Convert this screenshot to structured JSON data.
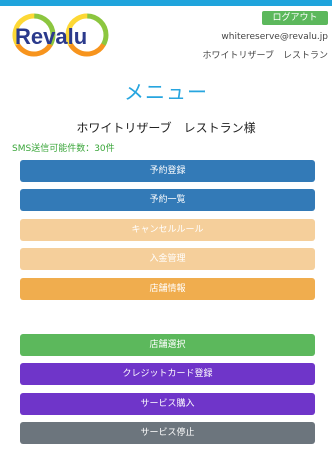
{
  "header": {
    "logo_text": "Revalu",
    "logout_label": "ログアウト",
    "user_email": "whitereserve@revalu.jp",
    "restaurant_name": "ホワイトリザーブ　レストラン"
  },
  "main": {
    "title": "メニュー",
    "restaurant_greeting": "ホワイトリザーブ　レストラン様",
    "sms_count_text": "SMS送信可能件数：30件"
  },
  "menu": {
    "items": [
      {
        "label": "予約登録",
        "color": "#337ab7"
      },
      {
        "label": "予約一覧",
        "color": "#337ab7"
      },
      {
        "label": "キャンセルルール",
        "color": "#f5cf9b"
      },
      {
        "label": "入金管理",
        "color": "#f5cf9b"
      },
      {
        "label": "店舗情報",
        "color": "#f0ad4e"
      },
      {
        "label": "店舗選択",
        "color": "#5cb85c"
      },
      {
        "label": "クレジットカード登録",
        "color": "#6f35c9"
      },
      {
        "label": "サービス購入",
        "color": "#6f35c9"
      },
      {
        "label": "サービス停止",
        "color": "#6c757d"
      }
    ]
  },
  "colors": {
    "topbar": "#1fa4dc",
    "title": "#27a5df",
    "logout": "#5cb85c"
  }
}
